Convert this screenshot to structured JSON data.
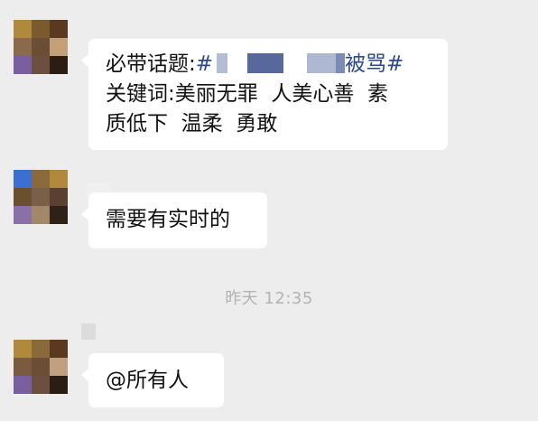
{
  "messages": [
    {
      "line1_a": "必带话题:",
      "line1_b": "#",
      "line1_c": "被骂#",
      "line2": "关键词:美丽无罪  人美心善  素",
      "line3": "质低下  温柔  勇敢"
    },
    {
      "text": "需要有实时的"
    },
    {
      "text": "@所有人"
    }
  ],
  "timestamp": "昨天 12:35",
  "colors": {
    "background": "#ededed",
    "bubble": "#ffffff",
    "topic_link": "#2c4a8a",
    "timestamp": "#b3b3b3"
  }
}
